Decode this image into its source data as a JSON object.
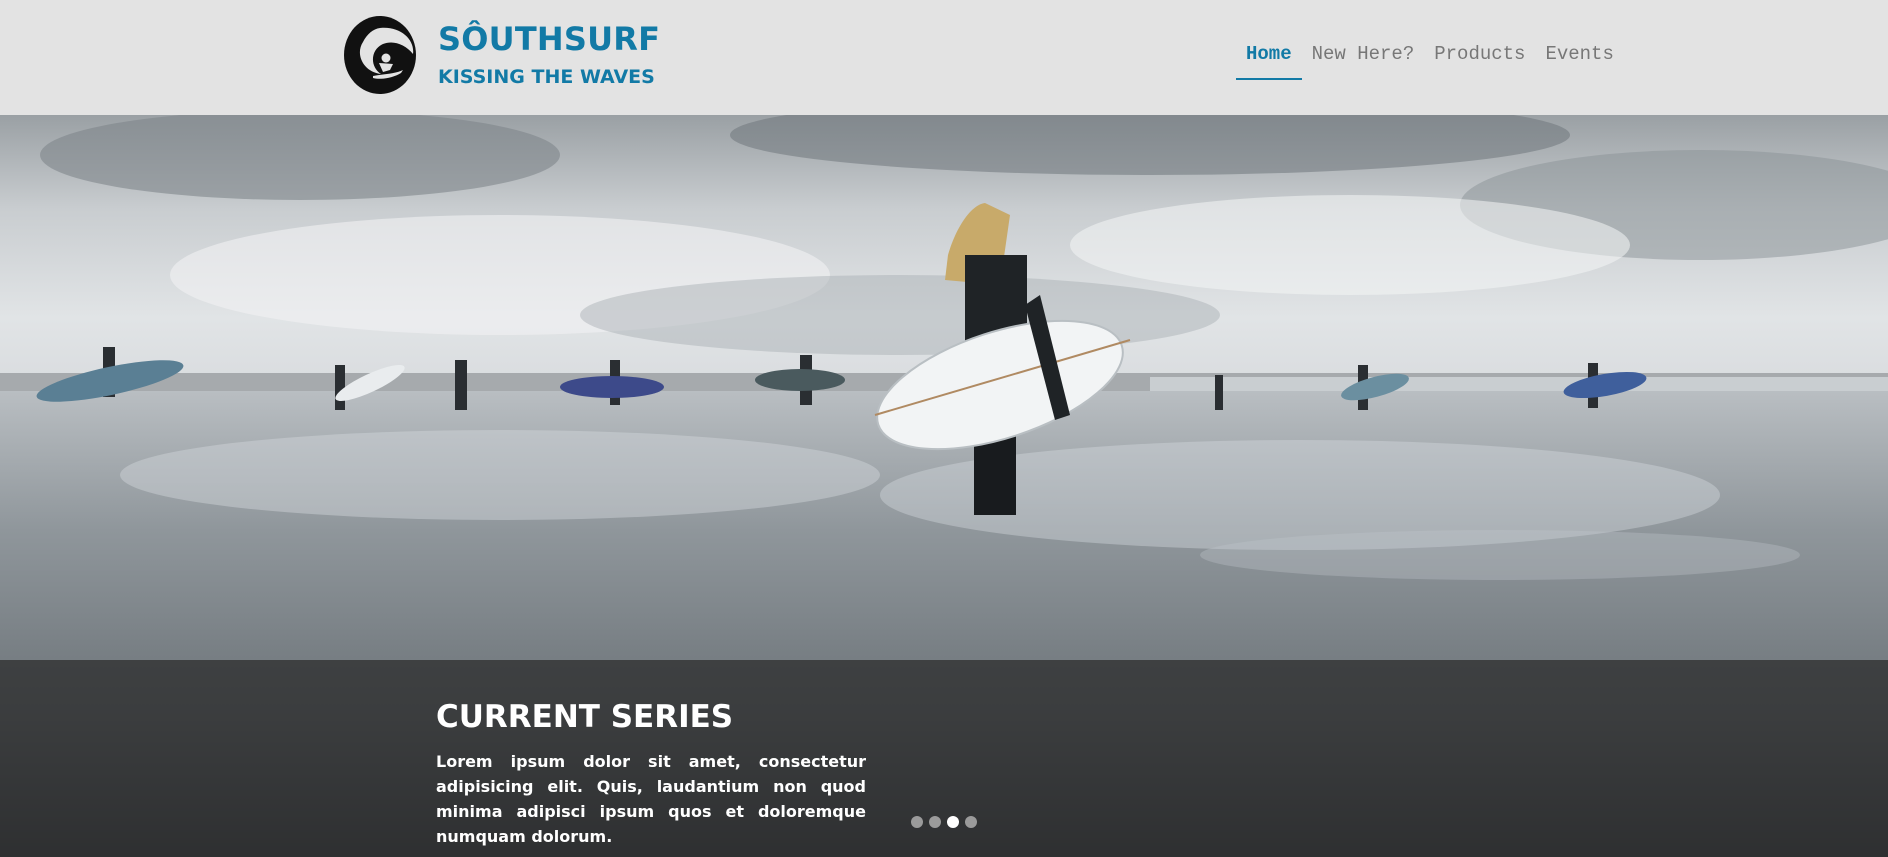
{
  "brand": {
    "name": "SÔUTHSURF",
    "tagline": "KISSING THE WAVES",
    "color": "#127aa6",
    "logo_icon": "surfer-wave-icon"
  },
  "nav": {
    "items": [
      {
        "label": "Home",
        "active": true
      },
      {
        "label": "New Here?",
        "active": false
      },
      {
        "label": "Products",
        "active": false
      },
      {
        "label": "Events",
        "active": false
      }
    ]
  },
  "hero": {
    "image": "surfers-on-wet-beach-photo",
    "caption": {
      "title": "CURRENT SERIES",
      "text": "Lorem ipsum dolor sit amet, consectetur adipisicing elit. Quis, laudantium non quod minima adipisci ipsum quos et doloremque numquam dolorum."
    },
    "slider": {
      "total": 4,
      "active_index": 3
    }
  },
  "colors": {
    "header_bg": "#e3e3e3",
    "nav_inactive": "#777777",
    "caption_overlay": "#282828"
  }
}
